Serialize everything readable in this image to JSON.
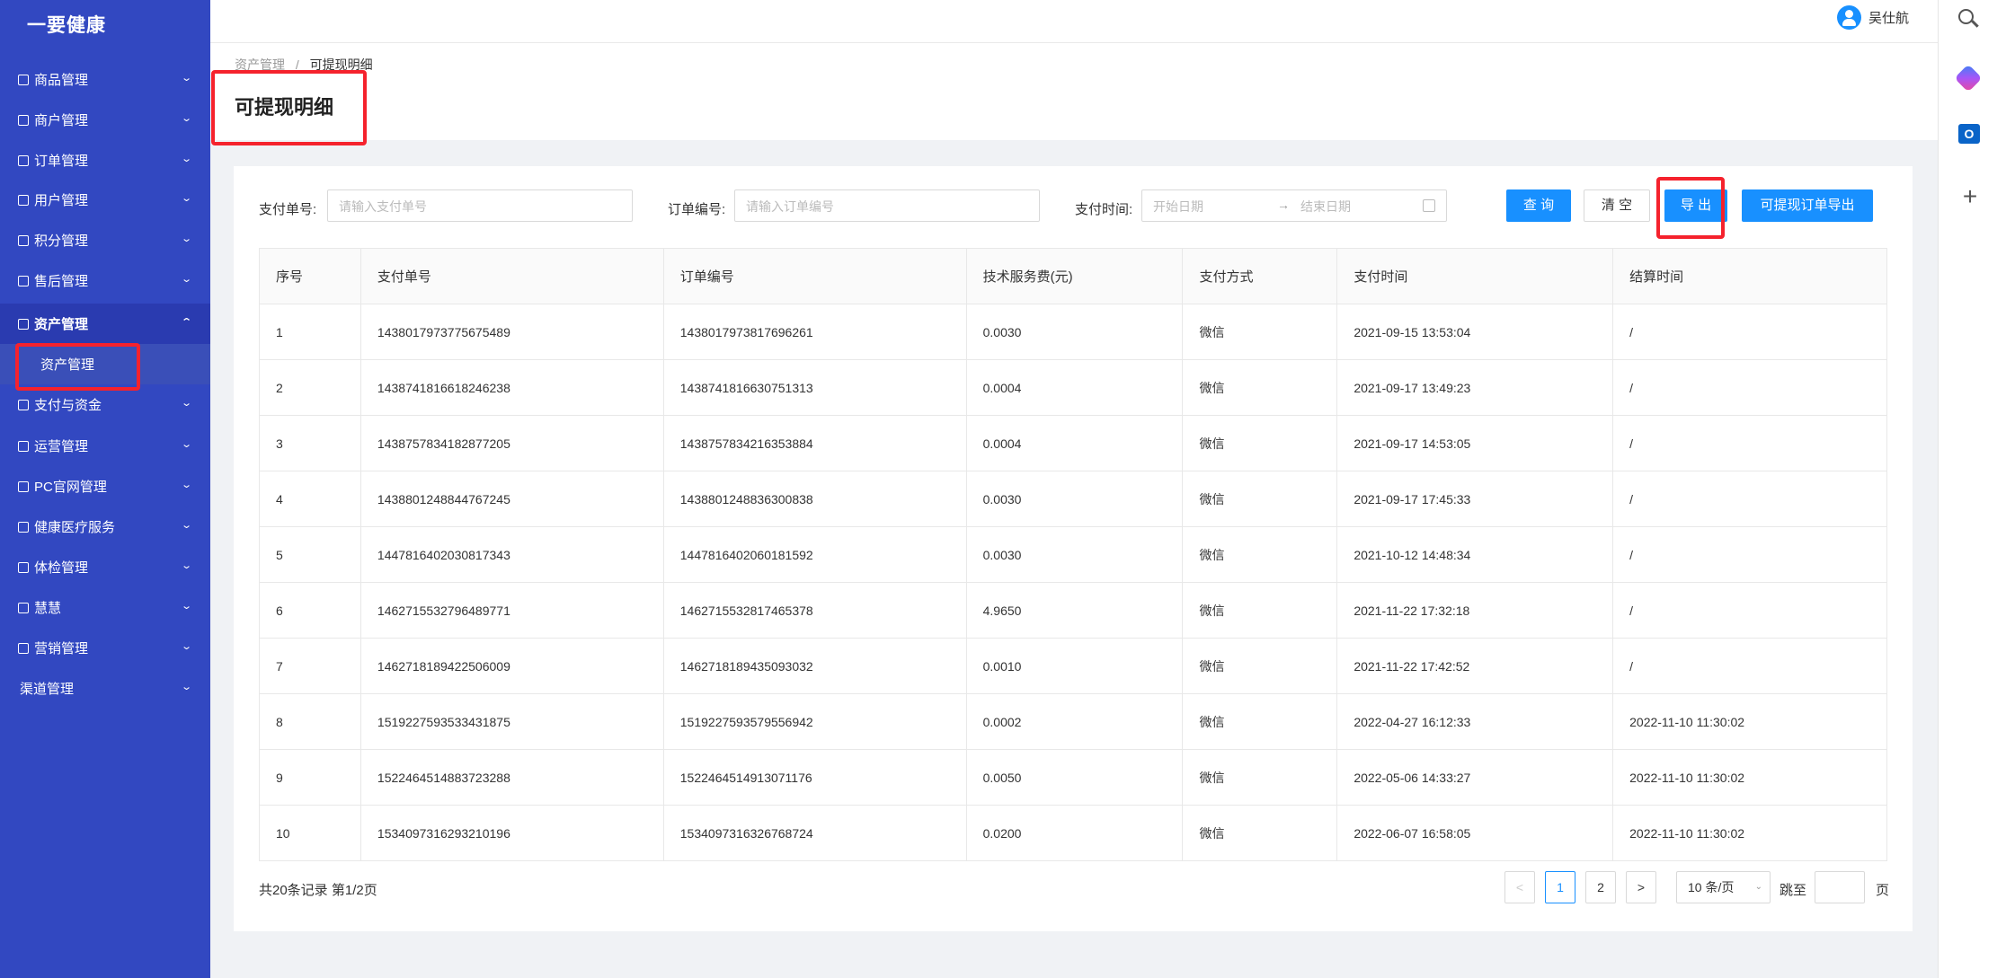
{
  "app": {
    "title": "一要健康"
  },
  "sidebar": {
    "items": [
      {
        "label": "商品管理",
        "icon": "box-icon"
      },
      {
        "label": "商户管理",
        "icon": "store-icon"
      },
      {
        "label": "订单管理",
        "icon": "order-icon"
      },
      {
        "label": "用户管理",
        "icon": "user-icon"
      },
      {
        "label": "积分管理",
        "icon": "points-icon"
      },
      {
        "label": "售后管理",
        "icon": "after-sale-icon"
      },
      {
        "label": "资产管理",
        "icon": "asset-icon",
        "active": true
      },
      {
        "label": "支付与资金",
        "icon": "wallet-icon"
      },
      {
        "label": "运营管理",
        "icon": "operation-icon"
      },
      {
        "label": "PC官网管理",
        "icon": "monitor-icon"
      },
      {
        "label": "健康医疗服务",
        "icon": "medical-icon"
      },
      {
        "label": "体检管理",
        "icon": "checkup-icon"
      },
      {
        "label": "慧慧",
        "icon": "headset-icon"
      },
      {
        "label": "营销管理",
        "icon": "gift-icon"
      },
      {
        "label": "渠道管理",
        "icon": ""
      }
    ],
    "submenu": {
      "label": "资产管理"
    }
  },
  "header": {
    "user_name": "吴仕航"
  },
  "breadcrumb": {
    "parent": "资产管理",
    "sep": "/",
    "current": "可提现明细"
  },
  "page": {
    "title": "可提现明细"
  },
  "filters": {
    "pay_no_label": "支付单号:",
    "pay_no_placeholder": "请输入支付单号",
    "order_no_label": "订单编号:",
    "order_no_placeholder": "请输入订单编号",
    "pay_time_label": "支付时间:",
    "start_placeholder": "开始日期",
    "range_arrow": "→",
    "end_placeholder": "结束日期"
  },
  "buttons": {
    "query": "查 询",
    "clear": "清 空",
    "export": "导 出",
    "export_orders": "可提现订单导出"
  },
  "table": {
    "headers": [
      "序号",
      "支付单号",
      "订单编号",
      "技术服务费(元)",
      "支付方式",
      "支付时间",
      "结算时间"
    ],
    "rows": [
      [
        "1",
        "1438017973775675489",
        "1438017973817696261",
        "0.0030",
        "微信",
        "2021-09-15 13:53:04",
        "/"
      ],
      [
        "2",
        "1438741816618246238",
        "1438741816630751313",
        "0.0004",
        "微信",
        "2021-09-17 13:49:23",
        "/"
      ],
      [
        "3",
        "1438757834182877205",
        "1438757834216353884",
        "0.0004",
        "微信",
        "2021-09-17 14:53:05",
        "/"
      ],
      [
        "4",
        "1438801248844767245",
        "1438801248836300838",
        "0.0030",
        "微信",
        "2021-09-17 17:45:33",
        "/"
      ],
      [
        "5",
        "1447816402030817343",
        "1447816402060181592",
        "0.0030",
        "微信",
        "2021-10-12 14:48:34",
        "/"
      ],
      [
        "6",
        "1462715532796489771",
        "1462715532817465378",
        "4.9650",
        "微信",
        "2021-11-22 17:32:18",
        "/"
      ],
      [
        "7",
        "1462718189422506009",
        "1462718189435093032",
        "0.0010",
        "微信",
        "2021-11-22 17:42:52",
        "/"
      ],
      [
        "8",
        "1519227593533431875",
        "1519227593579556942",
        "0.0002",
        "微信",
        "2022-04-27 16:12:33",
        "2022-11-10 11:30:02"
      ],
      [
        "9",
        "1522464514883723288",
        "1522464514913071176",
        "0.0050",
        "微信",
        "2022-05-06 14:33:27",
        "2022-11-10 11:30:02"
      ],
      [
        "10",
        "1534097316293210196",
        "1534097316326768724",
        "0.0200",
        "微信",
        "2022-06-07 16:58:05",
        "2022-11-10 11:30:02"
      ]
    ]
  },
  "pagination": {
    "summary": "共20条记录 第1/2页",
    "prev": "<",
    "pages": [
      "1",
      "2"
    ],
    "next": ">",
    "page_size": "10 条/页",
    "jump_label": "跳至",
    "page_unit": "页"
  },
  "colors": {
    "sidebar": "#3248c1",
    "primary": "#1890ff",
    "highlight": "#f5222d"
  }
}
